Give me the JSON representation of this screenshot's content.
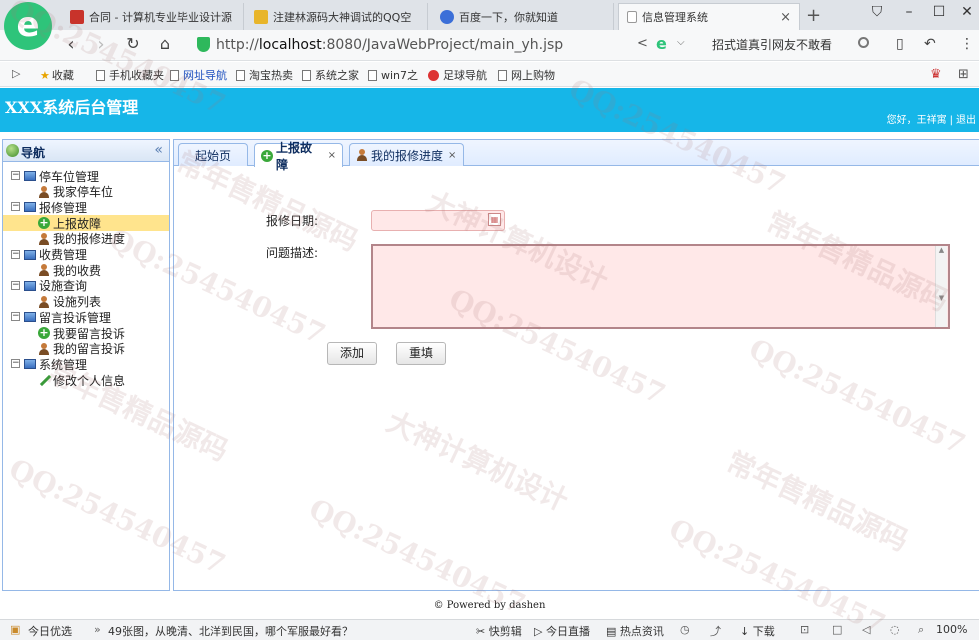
{
  "browser": {
    "tabs": [
      {
        "title": "合同 - 计算机专业毕业设计源",
        "favicon_color": "#c8332b"
      },
      {
        "title": "注建林源码大神调试的QQ空",
        "favicon_color": "#e8b52a"
      },
      {
        "title": "百度一下，你就知道",
        "favicon_color": "#3b6fd8"
      },
      {
        "title": "信息管理系统",
        "favicon_color": "#ffffff",
        "active": true
      }
    ],
    "url_prefix": "http://",
    "url_host": "localhost",
    "url_rest": ":8080/JavaWebProject/main_yh.jsp",
    "search_value": "招式道真引网友不敢看",
    "bookmarks": [
      "收藏",
      "手机收藏夹",
      "网址导航",
      "淘宝热卖",
      "系统之家",
      "win7之",
      "足球导航",
      "网上购物"
    ]
  },
  "app": {
    "title": "XXX系统后台管理",
    "user_greeting": "您好，王祥寓",
    "logout": "退出"
  },
  "sidebar": {
    "title": "导航",
    "tree": [
      {
        "label": "停车位管理",
        "children": [
          {
            "label": "我家停车位",
            "icon": "user-icon"
          }
        ]
      },
      {
        "label": "报修管理",
        "children": [
          {
            "label": "上报故障",
            "icon": "add-icon",
            "selected": true
          },
          {
            "label": "我的报修进度",
            "icon": "user-icon"
          }
        ]
      },
      {
        "label": "收费管理",
        "children": [
          {
            "label": "我的收费",
            "icon": "user-icon"
          }
        ]
      },
      {
        "label": "设施查询",
        "children": [
          {
            "label": "设施列表",
            "icon": "user-icon"
          }
        ]
      },
      {
        "label": "留言投诉管理",
        "children": [
          {
            "label": "我要留言投诉",
            "icon": "add-icon"
          },
          {
            "label": "我的留言投诉",
            "icon": "user-icon"
          }
        ]
      },
      {
        "label": "系统管理",
        "children": [
          {
            "label": "修改个人信息",
            "icon": "pencil-icon"
          }
        ]
      }
    ]
  },
  "content": {
    "tabs": [
      {
        "label": "起始页",
        "closable": false
      },
      {
        "label": "上报故障",
        "closable": true,
        "active": true
      },
      {
        "label": "我的报修进度",
        "closable": true
      }
    ],
    "form": {
      "date_label": "报修日期:",
      "date_value": "",
      "desc_label": "问题描述:",
      "desc_value": "",
      "add_button": "添加",
      "reset_button": "重填"
    },
    "footer": "© Powered by dashen"
  },
  "statusbar": {
    "left_label": "今日优选",
    "news": "49张图，从晚清、北洋到民国，哪个军服最好看？",
    "items": [
      "快剪辑",
      "今日直播",
      "热点资讯",
      "下载"
    ],
    "zoom": "100%"
  },
  "watermarks": [
    "QQ:254540457",
    "大神计算机设计",
    "常年售精品源码"
  ]
}
